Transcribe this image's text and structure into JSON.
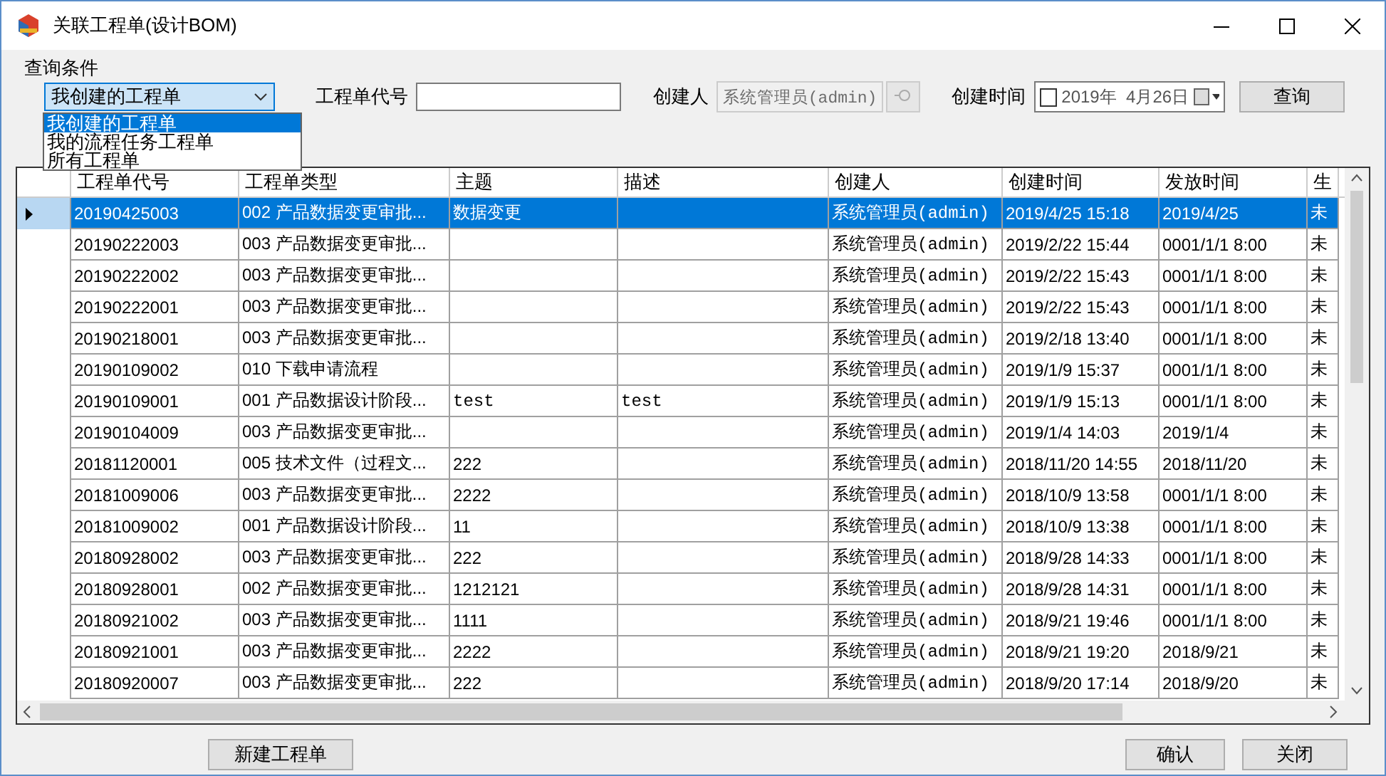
{
  "window": {
    "title": "关联工程单(设计BOM)"
  },
  "query": {
    "group_title": "查询条件",
    "scope": {
      "value": "我创建的工程单",
      "expanded": true,
      "options": [
        {
          "label": "我创建的工程单",
          "selected": true
        },
        {
          "label": "我的流程任务工程单",
          "selected": false
        },
        {
          "label": "所有工程单",
          "selected": false
        }
      ]
    },
    "code_label": "工程单代号",
    "creator_label": "创建人",
    "creator_value": "系统管理员(admin)",
    "creator_disabled": true,
    "time_label": "创建时间",
    "time_checked": false,
    "time_value": "2019年  4月26日",
    "search_button": "查询"
  },
  "table": {
    "columns": [
      "工程单代号",
      "工程单类型",
      "主题",
      "描述",
      "创建人",
      "创建时间",
      "发放时间",
      "生"
    ],
    "rows": [
      {
        "selected": true,
        "cells": [
          "20190425003",
          "002 产品数据变更审批...",
          "数据变更",
          "",
          "系统管理员(admin)",
          "2019/4/25 15:18",
          "2019/4/25",
          "未"
        ]
      },
      {
        "selected": false,
        "cells": [
          "20190222003",
          "003 产品数据变更审批...",
          "",
          "",
          "系统管理员(admin)",
          "2019/2/22 15:44",
          "0001/1/1 8:00",
          "未"
        ]
      },
      {
        "selected": false,
        "cells": [
          "20190222002",
          "003 产品数据变更审批...",
          "",
          "",
          "系统管理员(admin)",
          "2019/2/22 15:43",
          "0001/1/1 8:00",
          "未"
        ]
      },
      {
        "selected": false,
        "cells": [
          "20190222001",
          "003 产品数据变更审批...",
          "",
          "",
          "系统管理员(admin)",
          "2019/2/22 15:43",
          "0001/1/1 8:00",
          "未"
        ]
      },
      {
        "selected": false,
        "cells": [
          "20190218001",
          "003 产品数据变更审批...",
          "",
          "",
          "系统管理员(admin)",
          "2019/2/18 13:40",
          "0001/1/1 8:00",
          "未"
        ]
      },
      {
        "selected": false,
        "cells": [
          "20190109002",
          "010 下载申请流程",
          "",
          "",
          "系统管理员(admin)",
          "2019/1/9 15:37",
          "0001/1/1 8:00",
          "未"
        ]
      },
      {
        "selected": false,
        "cells": [
          "20190109001",
          "001 产品数据设计阶段...",
          "test",
          "test",
          "系统管理员(admin)",
          "2019/1/9 15:13",
          "0001/1/1 8:00",
          "未"
        ]
      },
      {
        "selected": false,
        "cells": [
          "20190104009",
          "003 产品数据变更审批...",
          "",
          "",
          "系统管理员(admin)",
          "2019/1/4 14:03",
          "2019/1/4",
          "未"
        ]
      },
      {
        "selected": false,
        "cells": [
          "20181120001",
          "005 技术文件（过程文...",
          "222",
          "",
          "系统管理员(admin)",
          "2018/11/20 14:55",
          "2018/11/20",
          "未"
        ]
      },
      {
        "selected": false,
        "cells": [
          "20181009006",
          "003 产品数据变更审批...",
          "2222",
          "",
          "系统管理员(admin)",
          "2018/10/9 13:58",
          "0001/1/1 8:00",
          "未"
        ]
      },
      {
        "selected": false,
        "cells": [
          "20181009002",
          "001 产品数据设计阶段...",
          "11",
          "",
          "系统管理员(admin)",
          "2018/10/9 13:38",
          "0001/1/1 8:00",
          "未"
        ]
      },
      {
        "selected": false,
        "cells": [
          "20180928002",
          "003 产品数据变更审批...",
          "222",
          "",
          "系统管理员(admin)",
          "2018/9/28 14:33",
          "0001/1/1 8:00",
          "未"
        ]
      },
      {
        "selected": false,
        "cells": [
          "20180928001",
          "002 产品数据变更审批...",
          "1212121",
          "",
          "系统管理员(admin)",
          "2018/9/28 14:31",
          "0001/1/1 8:00",
          "未"
        ]
      },
      {
        "selected": false,
        "cells": [
          "20180921002",
          "003 产品数据变更审批...",
          "1111",
          "",
          "系统管理员(admin)",
          "2018/9/21 19:46",
          "0001/1/1 8:00",
          "未"
        ]
      },
      {
        "selected": false,
        "cells": [
          "20180921001",
          "003 产品数据变更审批...",
          "2222",
          "",
          "系统管理员(admin)",
          "2018/9/21 19:20",
          "2018/9/21",
          "未"
        ]
      },
      {
        "selected": false,
        "cells": [
          "20180920007",
          "003 产品数据变更审批...",
          "222",
          "",
          "系统管理员(admin)",
          "2018/9/20 17:14",
          "2018/9/20",
          "未"
        ]
      }
    ]
  },
  "buttons": {
    "new": "新建工程单",
    "ok": "确认",
    "close": "关闭"
  }
}
